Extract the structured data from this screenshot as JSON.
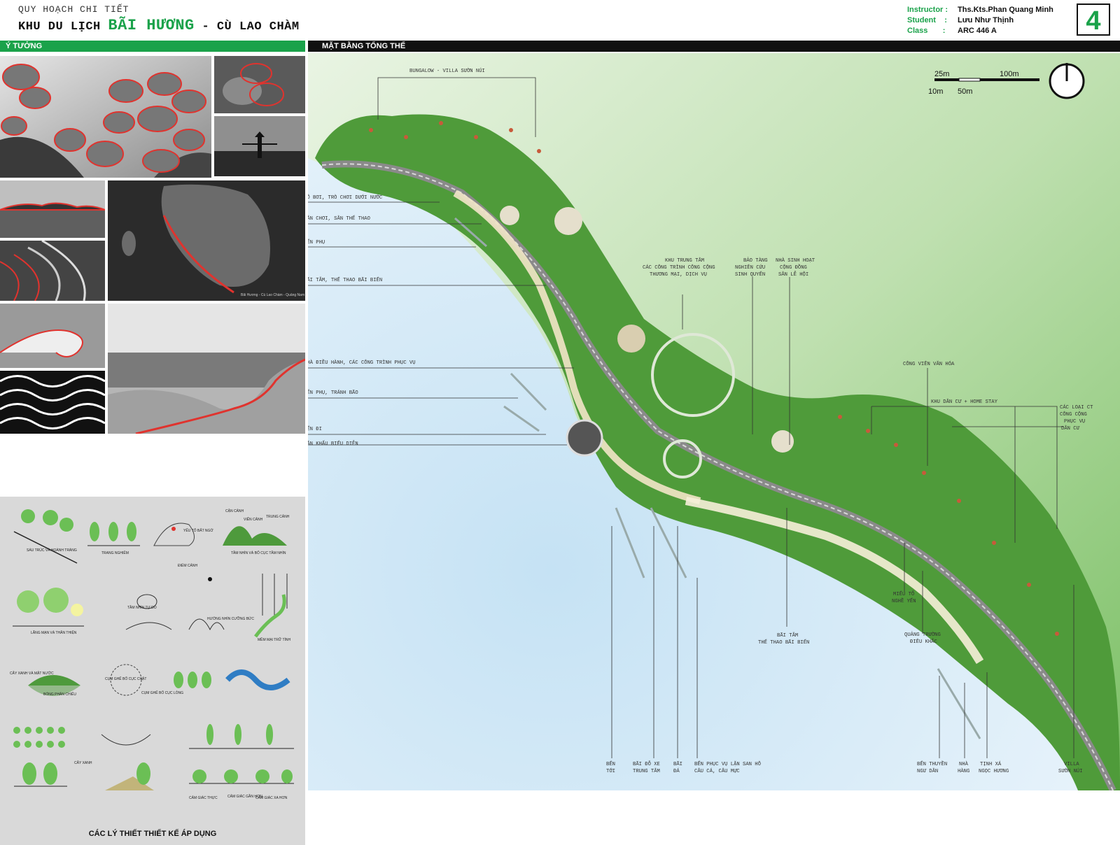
{
  "header": {
    "kicker": "QUY HOẠCH CHI TIẾT",
    "title_prefix": "KHU DU LỊCH ",
    "title_highlight": "BÃI HƯƠNG",
    "title_suffix": " - CÙ LAO CHÀM",
    "instructor_label": "Instructor :",
    "instructor_value": "Ths.Kts.Phan Quang Minh",
    "student_label": "Student",
    "student_sep": ":",
    "student_value": "Lưu Như Thịnh",
    "class_label": "Class",
    "class_sep": ":",
    "class_value": "ARC 446 A",
    "sheet_number": "4"
  },
  "sections": {
    "left_title": "Ý TƯỞNG",
    "right_title": "MẶT BẰNG TỔNG THỂ"
  },
  "concept": {
    "caption": "CÁC LÝ THIẾT THIẾT KẾ ÁP DỤNG",
    "labels": {
      "a1": "SÁU TRÚC VÀ HOÀNH TRÁNG",
      "a2": "TRANG NGHIÊM",
      "a3": "YẾU TỐ BẤT NGỜ",
      "a4": "ĐIỂM CẢNH",
      "a5": "CẬN CẢNH",
      "a6": "VIỄN CẢNH",
      "a7": "TRUNG CẢNH",
      "a8": "TẦM NHÌN VÀ BỐ CỤC TẦM NHÌN",
      "b1": "LÃNG MẠN VÀ THÂN THIỆN",
      "b2": "TẦM NHÌN TỰ DO",
      "b3": "HƯỚNG NHÌN CƯỠNG BỨC",
      "b4": "MỀM MẠI TRỮ TÌNH",
      "c1": "CÂY XANH VÀ MẶT NƯỚC",
      "c2": "BÓNG PHẢN CHIẾU",
      "c3": "CỤM GHẾ BỐ CỤC CHẶT",
      "c4": "CỤM GHẾ BỐ CỤC LỎNG",
      "d1": "CÂY XANH",
      "d2": "CẢM GIÁC THỰC",
      "d3": "CẢM GIÁC GẦN HƠN",
      "d4": "CẢM GIÁC XA HƠN"
    }
  },
  "scale": {
    "t25": "25m",
    "t100": "100m",
    "t10": "10m",
    "t50": "50m"
  },
  "map_labels": {
    "l1": "BUNGALOW - VILLA SƯỜN NÚI",
    "l2": "HỒ BƠI, TRÒ CHƠI DƯỚI NƯỚC",
    "l3": "SÂN CHƠI, SÂN THỂ THAO",
    "l4": "BẾN PHỤ",
    "l5": "BÃI TẮM, THỂ THAO BÃI BIỂN",
    "l6": "NHÀ ĐIỀU HÀNH, CÁC CÔNG TRÌNH PHỤC VỤ",
    "l7": "BẾN PHỤ, TRÁNH BÃO",
    "l8": "BẾN ĐI",
    "l9": "SÂN KHẤU BIỂU DIỄN",
    "c1a": "KHU TRUNG TÂM",
    "c1b": "CÁC CÔNG TRÌNH CÔNG CỘNG",
    "c1c": "THƯƠNG MẠI, DỊCH VỤ",
    "c2a": "BẢO TÀNG",
    "c2b": "NGHIÊN CỨU",
    "c2c": "SINH QUYỂN",
    "c3a": "NHÀ SINH HOẠT",
    "c3b": "CỘNG ĐỒNG",
    "c3c": "SÂN LỄ HỘI",
    "r1": "CÔNG VIÊN VĂN HÓA",
    "r2": "KHU DÂN CƯ + HOME STAY",
    "r3a": "CÁC LOẠI CT",
    "r3b": "CÔNG CỘNG",
    "r3c": "PHỤC VỤ",
    "r3d": "DÂN CƯ",
    "m1a": "MIẾU TỔ",
    "m1b": "NGHỀ YẾN",
    "m2a": "QUẢNG TRƯỜNG",
    "m2b": "ĐIÊU KHẮC",
    "m3a": "BÃI TẮM",
    "m3b": "THỂ THAO BÃI BIỂN",
    "b1a": "BẾN",
    "b1b": "TỚI",
    "b2a": "BÃI ĐỖ XE",
    "b2b": "TRUNG TÂM",
    "b3a": "BÃI",
    "b3b": "ĐÁ",
    "b4a": "BẾN PHỤC VỤ LẶN SAN HÔ",
    "b4b": "CÂU CÁ, CÂU MỰC",
    "b5a": "BẾN THUYỀN",
    "b5b": "NGƯ DÂN",
    "b6a": "NHÀ",
    "b6b": "HÀNG",
    "b7a": "TỊNH XÁ",
    "b7b": "NGỌC HƯƠNG",
    "b8a": "VILLA",
    "b8b": "SƯỜN NÚI"
  },
  "photo_caption": "Bãi Hương - Cù Lao Chàm - Quảng Nam",
  "colors": {
    "accent": "#1aa24a",
    "sea": "#c9e3f2",
    "land": "#7fc46b",
    "route": "#e0332e"
  }
}
